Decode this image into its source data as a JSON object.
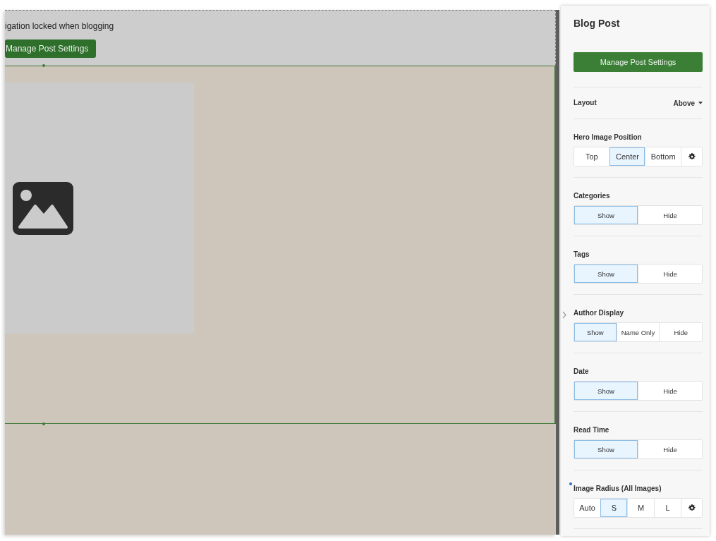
{
  "canvas": {
    "notice": "igation locked when blogging",
    "button": "Manage Post Settings"
  },
  "panel": {
    "title": "Blog Post",
    "button": "Manage Post Settings",
    "layout": {
      "label": "Layout",
      "value": "Above"
    },
    "sections": [
      {
        "label": "Hero Image Position",
        "modified": false,
        "settings": true,
        "options": [
          {
            "label": "Top",
            "selected": false
          },
          {
            "label": "Center",
            "selected": true
          },
          {
            "label": "Bottom",
            "selected": false
          }
        ]
      },
      {
        "label": "Categories",
        "modified": false,
        "settings": false,
        "options": [
          {
            "label": "Show",
            "selected": true
          },
          {
            "label": "Hide",
            "selected": false
          }
        ]
      },
      {
        "label": "Tags",
        "modified": false,
        "settings": false,
        "options": [
          {
            "label": "Show",
            "selected": true
          },
          {
            "label": "Hide",
            "selected": false
          }
        ]
      },
      {
        "label": "Author Display",
        "modified": false,
        "settings": false,
        "options": [
          {
            "label": "Show",
            "selected": true
          },
          {
            "label": "Name Only",
            "selected": false
          },
          {
            "label": "Hide",
            "selected": false
          }
        ]
      },
      {
        "label": "Date",
        "modified": false,
        "settings": false,
        "options": [
          {
            "label": "Show",
            "selected": true
          },
          {
            "label": "Hide",
            "selected": false
          }
        ]
      },
      {
        "label": "Read Time",
        "modified": false,
        "settings": false,
        "options": [
          {
            "label": "Show",
            "selected": true
          },
          {
            "label": "Hide",
            "selected": false
          }
        ]
      },
      {
        "label": "Image Radius (All Images)",
        "modified": true,
        "settings": true,
        "options": [
          {
            "label": "Auto",
            "selected": false
          },
          {
            "label": "S",
            "selected": true
          },
          {
            "label": "M",
            "selected": false
          },
          {
            "label": "L",
            "selected": false
          }
        ]
      }
    ]
  }
}
